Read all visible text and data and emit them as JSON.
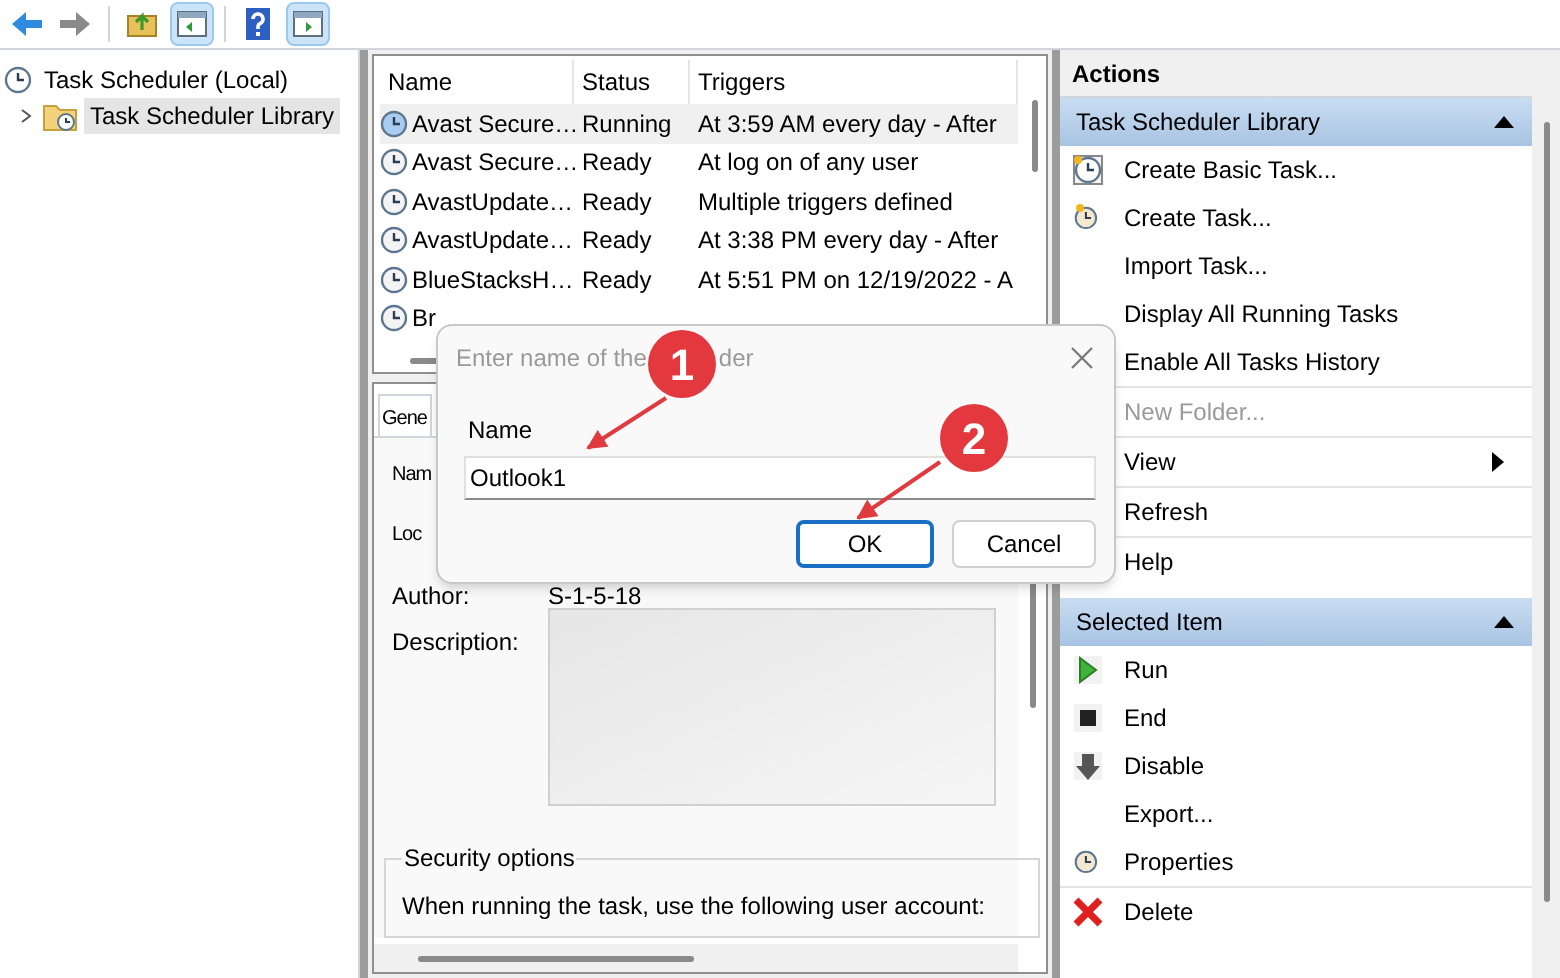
{
  "toolbar": [
    {
      "pressed": false
    },
    {
      "pressed": false
    },
    {
      "pressed": false
    },
    {
      "pressed": true
    },
    {
      "pressed": false
    },
    {
      "pressed": true
    }
  ],
  "tree": [
    {
      "label": "Task Scheduler (Local)",
      "selected": false,
      "children": [
        {
          "label": "Task Scheduler Library",
          "selected": true,
          "expanded": false
        }
      ]
    }
  ],
  "table": {
    "columns": [
      "Name",
      "Status",
      "Triggers"
    ],
    "rows": [
      {
        "name": "Avast Secure…",
        "status": "Running",
        "trigger": "At 3:59 AM every day - After",
        "running": true,
        "selected": true
      },
      {
        "name": "Avast Secure…",
        "status": "Ready",
        "trigger": "At log on of any user",
        "running": false,
        "selected": false
      },
      {
        "name": "AvastUpdate…",
        "status": "Ready",
        "trigger": "Multiple triggers defined",
        "running": false,
        "selected": false
      },
      {
        "name": "AvastUpdate…",
        "status": "Ready",
        "trigger": "At 3:38 PM every day - After",
        "running": false,
        "selected": false
      },
      {
        "name": "BlueStacksH…",
        "status": "Ready",
        "trigger": "At 5:51 PM on 12/19/2022 - A",
        "running": false,
        "selected": false
      },
      {
        "name": "Br",
        "running": false,
        "selected": false
      }
    ]
  },
  "details": {
    "tab": "Gene",
    "fields": [
      {
        "label": "Nam"
      },
      {
        "label": "Loc"
      },
      {
        "label": "Author:",
        "value": "S-1-5-18"
      },
      {
        "label": "Description:"
      }
    ],
    "security": {
      "title": "Security options",
      "text": "When running the task, use the following user account:"
    }
  },
  "actions": {
    "title": "Actions",
    "sections": [
      {
        "title": "Task Scheduler Library",
        "expanded": true,
        "items": [
          {
            "label": "Create Basic Task...",
            "disabled": false
          },
          {
            "label": "Create Task...",
            "disabled": false
          },
          {
            "label": "Import Task...",
            "disabled": false
          },
          {
            "label": "Display All Running Tasks",
            "disabled": false
          },
          {
            "label": "Enable All Tasks History",
            "disabled": false
          },
          {
            "label": "New Folder...",
            "disabled": true,
            "divider_above": true
          },
          {
            "label": "View",
            "disabled": false,
            "submenu": true,
            "divider_above": true
          },
          {
            "label": "Refresh",
            "disabled": false,
            "divider_above": true
          },
          {
            "label": "Help",
            "disabled": false,
            "divider_above": true
          }
        ]
      },
      {
        "title": "Selected Item",
        "expanded": true,
        "items": [
          {
            "label": "Run",
            "disabled": false
          },
          {
            "label": "End",
            "disabled": false
          },
          {
            "label": "Disable",
            "disabled": false
          },
          {
            "label": "Export...",
            "disabled": false
          },
          {
            "label": "Properties",
            "disabled": false
          },
          {
            "label": "Delete",
            "disabled": false,
            "divider_above": true
          }
        ]
      }
    ]
  },
  "dialog": {
    "title_start": "Enter name of the",
    "title_end": "der",
    "field_label": "Name",
    "value": "Outlook1",
    "buttons": [
      {
        "label": "OK",
        "default": true
      },
      {
        "label": "Cancel",
        "default": false
      }
    ]
  },
  "annotations": [
    {
      "label": "1"
    },
    {
      "label": "2"
    }
  ]
}
